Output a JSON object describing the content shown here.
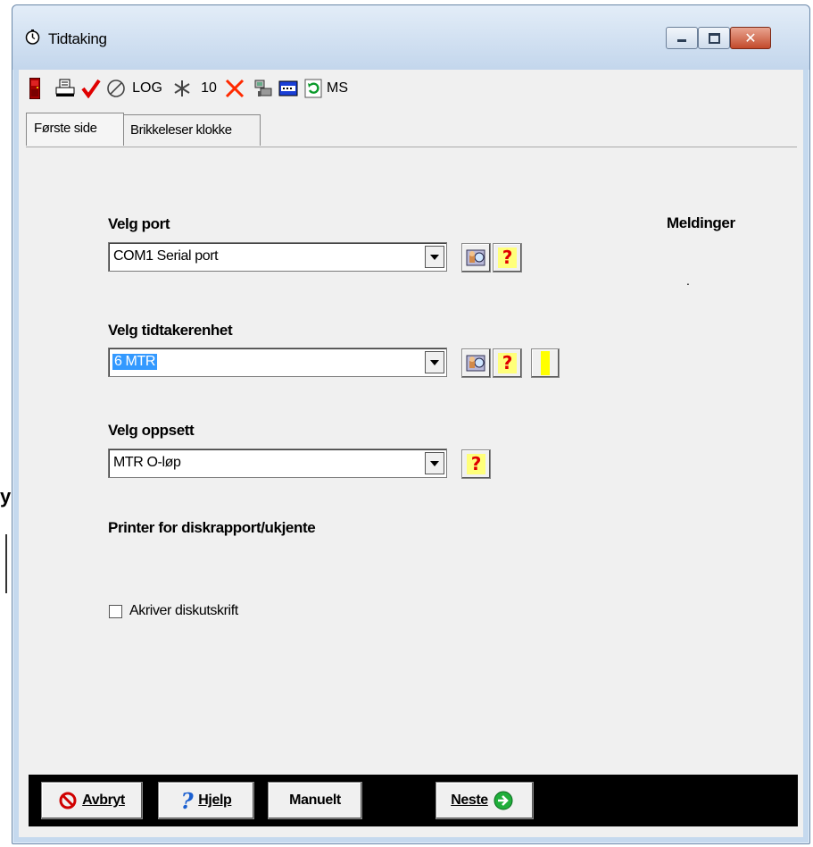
{
  "window": {
    "title": "Tidtaking"
  },
  "toolbar": {
    "log_label": "LOG",
    "count_label": "10",
    "ms_label": "MS",
    "icons": [
      "door-exit-icon",
      "printer-icon",
      "checkmark-icon",
      "cancel-circle-icon",
      "log-button",
      "asterisk-icon",
      "ten-button",
      "delete-x-icon",
      "computer-icon",
      "card-reader-icon",
      "refresh-icon",
      "ms-button"
    ]
  },
  "tabs": [
    {
      "label": "Første side",
      "active": true
    },
    {
      "label": "Brikkeleser klokke",
      "active": false
    }
  ],
  "form": {
    "port_label": "Velg port",
    "port_value": "COM1 Serial port",
    "unit_label": "Velg tidtakerenhet",
    "unit_value": "6 MTR",
    "setup_label": "Velg oppsett",
    "setup_value": "MTR O-løp",
    "printer_label": "Printer for diskrapport/ukjente",
    "checkbox_label": "Akriver diskutskrift",
    "checkbox_checked": false
  },
  "messages": {
    "label": "Meldinger",
    "text": "."
  },
  "footer": {
    "cancel_label": "Avbryt",
    "help_label": "Hjelp",
    "manual_label": "Manuelt",
    "next_label": "Neste"
  },
  "colors": {
    "accent_red": "#e00000",
    "help_bg": "#ffff7a",
    "selection": "#3399ff"
  }
}
